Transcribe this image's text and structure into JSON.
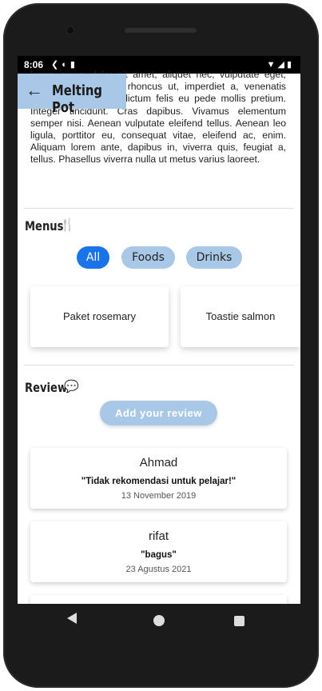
{
  "status_bar": {
    "time": "8:06",
    "left_icons": [
      "flutter-icon",
      "data-saver-icon",
      "sim-card-icon"
    ],
    "right_icons": [
      "wifi-icon",
      "signal-icon",
      "battery-icon"
    ]
  },
  "app_bar": {
    "title": "Melting Pot",
    "back_icon": "arrow-left-icon"
  },
  "description": "lorem ipsum dolor sit amet, aliquet nec, vulputate eget, arcu. In enim justo, rhoncus ut, imperdiet a, venenatis vitae, justo. Nullam dictum felis eu pede mollis pretium. Integer tincidunt. Cras dapibus. Vivamus elementum semper nisi. Aenean vulputate eleifend tellus. Aenean leo ligula, porttitor eu, consequat vitae, eleifend ac, enim. Aliquam lorem ante, dapibus in, viverra quis, feugiat a, tellus. Phasellus viverra nulla ut metus varius laoreet.",
  "menus": {
    "title": "Menus",
    "icon": "food-bank-icon",
    "filters": [
      {
        "label": "All",
        "active": true
      },
      {
        "label": "Foods",
        "active": false
      },
      {
        "label": "Drinks",
        "active": false
      }
    ],
    "items": [
      "Paket rosemary",
      "Toastie salmon"
    ]
  },
  "review": {
    "title": "Review",
    "icon": "add-comment-icon",
    "add_button": "Add your review",
    "items": [
      {
        "name": "Ahmad",
        "comment": "\"Tidak rekomendasi untuk pelajar!\"",
        "date": "13 November 2019"
      },
      {
        "name": "rifat",
        "comment": "\"bagus\"",
        "date": "23 Agustus 2021"
      }
    ]
  },
  "colors": {
    "accent": "#1a73e8",
    "chip": "#a9c7e6",
    "app_bar": "#a9c7e6"
  }
}
